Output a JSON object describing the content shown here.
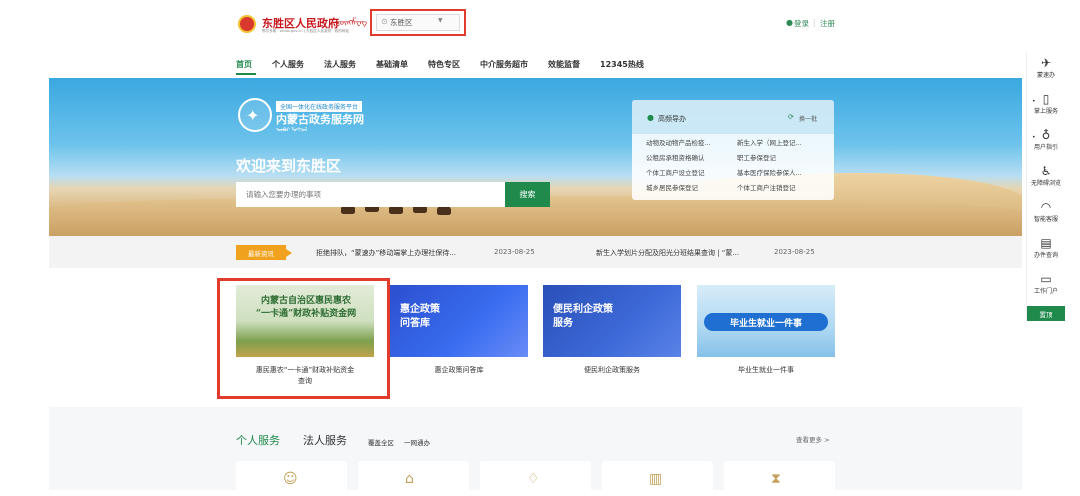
{
  "header": {
    "site_title": "东胜区人民政府",
    "mongol_title": "ᠳ᠋ᠦᠩᠱᠧᠩ",
    "site_sub": "鄂尔多斯 · ordos.gov.cn   |   东胜区人民政府 · 政府网站",
    "region": "东胜区",
    "login": "登录",
    "separator": "|",
    "register": "注册"
  },
  "nav": {
    "items": [
      "首页",
      "个人服务",
      "法人服务",
      "基础清单",
      "特色专区",
      "中介服务超市",
      "效能监督",
      "12345热线"
    ],
    "active": "首页"
  },
  "banner": {
    "tagline": "全国一体化在线政务服务平台",
    "portal_name": "内蒙古政务服务网",
    "mongol_sub": "ᠦᠪᠦᠷ ᠮᠣᠩᠭᠣᠯ",
    "welcome": "欢迎来到东胜区",
    "search_placeholder": "请输入您要办理的事项",
    "search_button": "搜索"
  },
  "hot": {
    "title": "高频导办",
    "refresh": "换一批",
    "links": [
      "动物及动物产品检疫...",
      "新生入学（网上登记...",
      "公租房承租资格确认",
      "职工参保登记",
      "个体工商户设立登记",
      "基本医疗保险参保人...",
      "城乡居民参保登记",
      "个体工商户注销登记"
    ]
  },
  "news": {
    "badge": "最新资讯",
    "items": [
      {
        "text": "拒绝排队，“蒙速办”移动端掌上办理社保待...",
        "date": "2023-08-25"
      },
      {
        "text": "新生入学划片分配及阳光分班结果查询 | “蒙...",
        "date": "2023-08-25"
      }
    ]
  },
  "cards": [
    {
      "image_text": "内蒙古自治区惠民惠农\n“一卡通”财政补贴资金网",
      "label": "惠民惠农“一卡通”财政补贴资金\n查询"
    },
    {
      "image_text": "惠企政策\n问答库",
      "label": "惠企政策问答库"
    },
    {
      "image_text": "便民利企政策\n服务",
      "label": "便民利企政策服务"
    },
    {
      "image_text": "毕业生就业一件事",
      "label": "毕业生就业一件事"
    }
  ],
  "services": {
    "tab_personal": "个人服务",
    "tab_legal": "法人服务",
    "cover_all": "覆盖全区",
    "one_net": "一网通办",
    "see_more": "查看更多 >"
  },
  "sidebar": {
    "items": [
      "蒙速办",
      "掌上服务",
      "用户指引",
      "无障碍浏览",
      "智能客服",
      "办件查询",
      "工作门户"
    ],
    "top": "置顶"
  },
  "colors": {
    "accent": "#1f8a4c",
    "highlight": "#e03b2d",
    "badge": "#f0a11d"
  }
}
